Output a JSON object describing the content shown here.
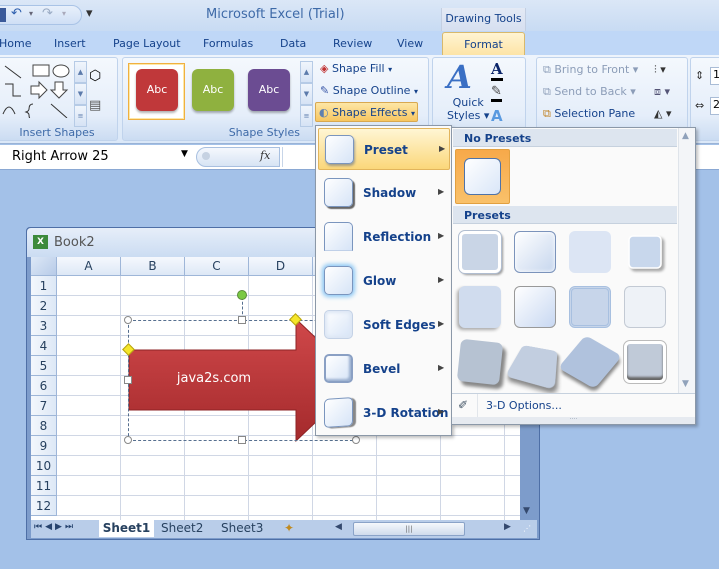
{
  "title_bar": {
    "app_title": "Microsoft Excel (Trial)",
    "contextual_header": "Drawing Tools",
    "quick_access": {
      "undo_icon": "↶",
      "redo_icon": "↷",
      "customize_icon": "▾"
    }
  },
  "ribbon_tabs": [
    {
      "label": "Home"
    },
    {
      "label": "Insert"
    },
    {
      "label": "Page Layout"
    },
    {
      "label": "Formulas"
    },
    {
      "label": "Data"
    },
    {
      "label": "Review"
    },
    {
      "label": "View"
    },
    {
      "label": "Format",
      "active": true
    }
  ],
  "ribbon": {
    "insert_shapes": {
      "label": "Insert Shapes"
    },
    "shape_styles": {
      "label": "Shape Styles",
      "swatches": [
        {
          "text": "Abc",
          "color": "#c0383a",
          "selected": true
        },
        {
          "text": "Abc",
          "color": "#8fb13f"
        },
        {
          "text": "Abc",
          "color": "#6b4c92"
        }
      ],
      "shape_fill": "Shape Fill",
      "shape_outline": "Shape Outline",
      "shape_effects": "Shape Effects"
    },
    "wordart": {
      "quick_styles_line1": "Quick",
      "quick_styles_line2": "Styles"
    },
    "arrange": {
      "bring_to_front": "Bring to Front",
      "send_to_back": "Send to Back",
      "selection_pane": "Selection Pane"
    },
    "size": {
      "height_value": "1",
      "width_value": "2"
    }
  },
  "formula_bar": {
    "name_box": "Right Arrow 25",
    "fx_label": "fx",
    "formula_value": ""
  },
  "workbook": {
    "title": "Book2",
    "columns": [
      "A",
      "B",
      "C",
      "D"
    ],
    "rows": [
      "1",
      "2",
      "3",
      "4",
      "5",
      "6",
      "7",
      "8",
      "9",
      "10",
      "11",
      "12"
    ],
    "sheets": [
      {
        "label": "Sheet1",
        "active": true
      },
      {
        "label": "Sheet2"
      },
      {
        "label": "Sheet3"
      }
    ],
    "shape_text": "java2s.com",
    "shape_color": "#c0383a"
  },
  "effects_menu": {
    "items": [
      {
        "label": "Preset",
        "active": true
      },
      {
        "label": "Shadow"
      },
      {
        "label": "Reflection"
      },
      {
        "label": "Glow"
      },
      {
        "label": "Soft Edges"
      },
      {
        "label": "Bevel"
      },
      {
        "label": "3-D Rotation"
      }
    ]
  },
  "preset_gallery": {
    "no_presets_header": "No Presets",
    "presets_header": "Presets",
    "preset_count": 12,
    "footer_label": "3-D Options..."
  }
}
